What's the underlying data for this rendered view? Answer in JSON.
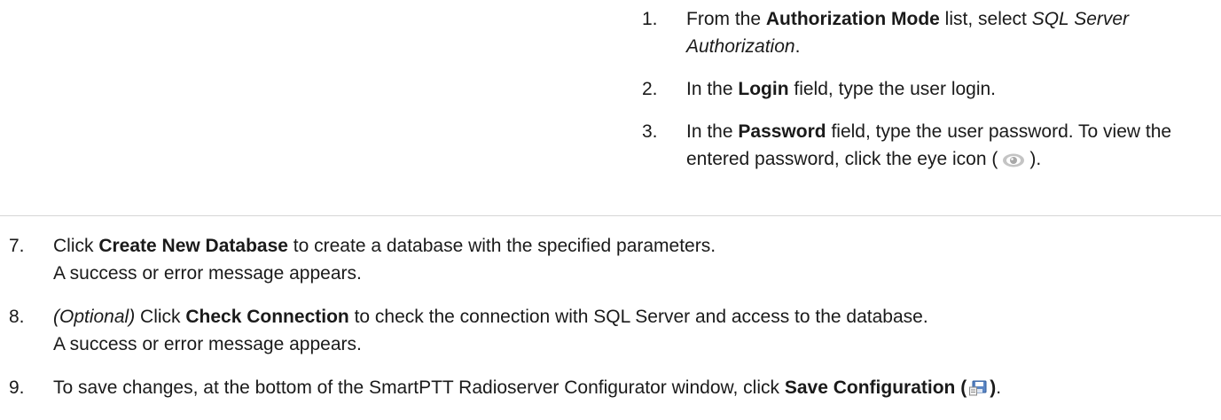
{
  "substeps": [
    {
      "num": "1.",
      "pre": "From the ",
      "bold": "Authorization Mode",
      "mid": " list, select ",
      "italic": "SQL Server Authorization",
      "post": "."
    },
    {
      "num": "2.",
      "pre": "In the ",
      "bold": "Login",
      "post": " field, type the user login."
    },
    {
      "num": "3.",
      "pre": "In the ",
      "bold": "Password",
      "mid": " field, type the user password. To view the entered password, click the eye icon (",
      "post": ")."
    }
  ],
  "steps": [
    {
      "num": "7.",
      "pre": "Click ",
      "bold": "Create New Database",
      "post": " to create a database with the specified parameters.",
      "line2": "A success or error message appears."
    },
    {
      "num": "8.",
      "italic": "(Optional)",
      "pre": " Click ",
      "bold": "Check Connection",
      "post": " to check the connection with SQL Server and access to the database.",
      "line2": "A success or error message appears."
    },
    {
      "num": "9.",
      "pre": "To save changes, at the bottom of the SmartPTT Radioserver Configurator window, click ",
      "bold": "Save Configuration (",
      "bold2": ")",
      "post": "."
    }
  ],
  "icons": {
    "eye": "eye-icon",
    "save": "save-configuration-icon"
  }
}
